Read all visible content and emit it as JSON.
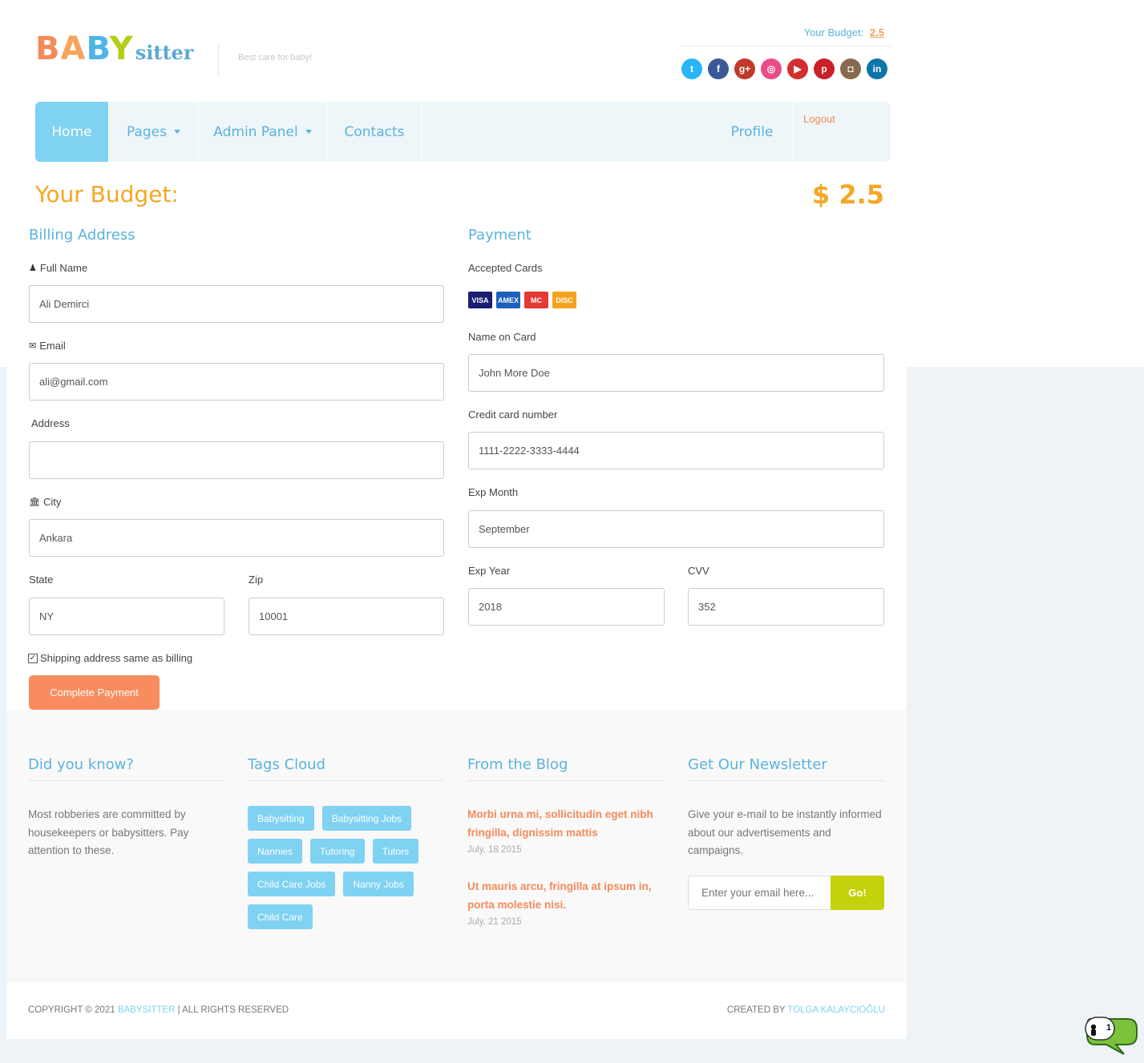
{
  "header": {
    "logo_baby": "BABY",
    "logo_sitter": "sitter",
    "tagline": "Best care for baby!",
    "budget_label": "Your Budget:",
    "budget_value": "2.5",
    "social": [
      {
        "name": "twitter-icon",
        "glyph": "t",
        "color": "#29b6f6"
      },
      {
        "name": "facebook-icon",
        "glyph": "f",
        "color": "#3b5998"
      },
      {
        "name": "google-plus-icon",
        "glyph": "g+",
        "color": "#c0392b"
      },
      {
        "name": "dribbble-icon",
        "glyph": "◎",
        "color": "#ea4c89"
      },
      {
        "name": "youtube-icon",
        "glyph": "▶",
        "color": "#d32f2f"
      },
      {
        "name": "pinterest-icon",
        "glyph": "p",
        "color": "#cb2027"
      },
      {
        "name": "instagram-icon",
        "glyph": "◘",
        "color": "#8a6a4f"
      },
      {
        "name": "linkedin-icon",
        "glyph": "in",
        "color": "#0e76a8"
      }
    ]
  },
  "nav": {
    "home": "Home",
    "pages": "Pages",
    "admin_panel": "Admin Panel",
    "contacts": "Contacts",
    "profile": "Profile",
    "logout": "Logout"
  },
  "budget": {
    "title": "Your Budget:",
    "amount": "$ 2.5"
  },
  "billing": {
    "title": "Billing Address",
    "full_name_label": "Full Name",
    "full_name_value": "Ali Demirci",
    "email_label": "Email",
    "email_value": "ali@gmail.com",
    "address_label": "Address",
    "address_value": "",
    "city_label": "City",
    "city_value": "Ankara",
    "state_label": "State",
    "state_value": "NY",
    "zip_label": "Zip",
    "zip_value": "10001",
    "shipping_same": "Shipping address same as billing",
    "submit": "Complete Payment"
  },
  "payment": {
    "title": "Payment",
    "accepted_cards_label": "Accepted Cards",
    "cards": [
      {
        "name": "visa-card-icon",
        "text": "VISA",
        "color": "#1a1f71"
      },
      {
        "name": "amex-card-icon",
        "text": "AMEX",
        "color": "#1d5fbf"
      },
      {
        "name": "mastercard-icon",
        "text": "MC",
        "color": "#e53935"
      },
      {
        "name": "discover-card-icon",
        "text": "DISC",
        "color": "#f7a21b"
      }
    ],
    "name_on_card_label": "Name on Card",
    "name_on_card_value": "John More Doe",
    "card_number_label": "Credit card number",
    "card_number_value": "1111-2222-3333-4444",
    "exp_month_label": "Exp Month",
    "exp_month_value": "September",
    "exp_year_label": "Exp Year",
    "exp_year_value": "2018",
    "cvv_label": "CVV",
    "cvv_value": "352"
  },
  "footer": {
    "did_you_know_title": "Did you know?",
    "did_you_know_text": "Most robberies are committed by housekeepers or babysitters. Pay attention to these.",
    "tags_title": "Tags Cloud",
    "tags": [
      "Babysitting",
      "Babysitting Jobs",
      "Nannies",
      "Tutoring",
      "Tutors",
      "Child Care Jobs",
      "Nanny Jobs",
      "Child Care"
    ],
    "blog_title": "From the Blog",
    "blog_posts": [
      {
        "title": "Morbi urna mi, sollicitudin eget nibh fringilla, dignissim mattis",
        "date": "July, 18 2015"
      },
      {
        "title": "Ut mauris arcu, fringilla at ipsum in, porta molestie nisi.",
        "date": "July, 21 2015"
      }
    ],
    "newsletter_title": "Get Our Newsletter",
    "newsletter_text": "Give your e-mail to be instantly informed about our advertisements and campaigns.",
    "newsletter_placeholder": "Enter your email here...",
    "newsletter_button": "Go!"
  },
  "copyright": {
    "left_prefix": "COPYRIGHT © 2021",
    "brand": "BABYSITTER",
    "left_suffix": "|  ALL RIGHTS RESERVED",
    "right_prefix": "CREATED BY",
    "author": "TOLGA KALAYCIOĞLU"
  },
  "chat": {
    "count": "1"
  },
  "colors": {
    "accent_blue": "#5bb3dd",
    "accent_orange": "#f58a5a",
    "budget_orange": "#f5a623",
    "newsletter_green": "#c4d10b"
  }
}
